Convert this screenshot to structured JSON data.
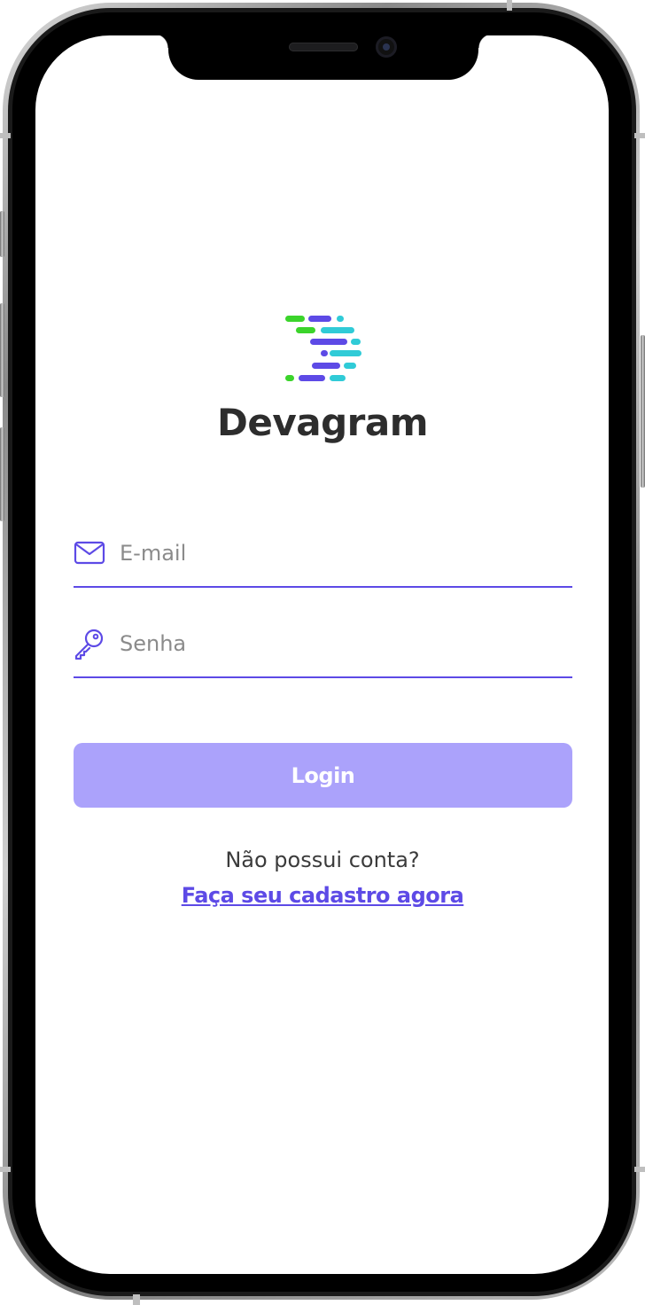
{
  "app": {
    "brand_name": "Devagram"
  },
  "login_form": {
    "email_placeholder": "E-mail",
    "password_placeholder": "Senha",
    "login_label": "Login"
  },
  "signup": {
    "prompt": "Não possui conta?",
    "link_label": "Faça seu cadastro agora"
  },
  "icons": {
    "email": "mail-icon",
    "password": "key-icon"
  },
  "colors": {
    "accent": "#5d4ae6",
    "button_disabled": "#aba2fb",
    "logo_green": "#3bd42b",
    "logo_purple": "#5d4ae6",
    "logo_cyan": "#30cbd7",
    "text_dark": "#2d2d2d"
  }
}
